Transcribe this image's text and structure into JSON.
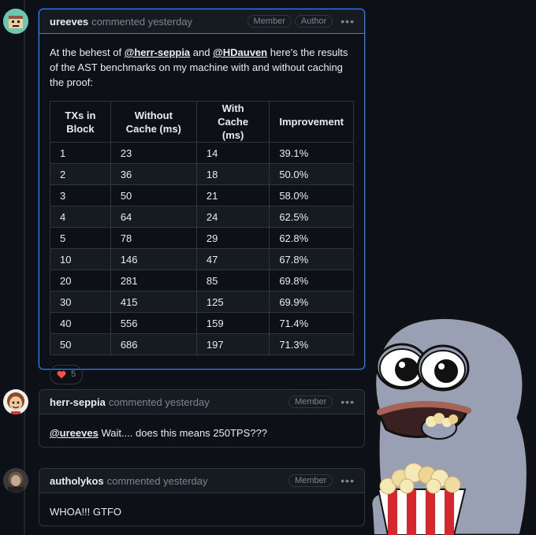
{
  "comments": [
    {
      "author": "ureeves",
      "meta": "commented yesterday",
      "badges": [
        "Member",
        "Author"
      ],
      "text_parts": [
        "At the behest of ",
        "@herr-seppia",
        " and ",
        "@HDauven",
        " here's the results of the AST benchmarks on my machine with and without caching the proof:"
      ],
      "table": {
        "headers": [
          "TXs in Block",
          "Without Cache (ms)",
          "With Cache (ms)",
          "Improvement"
        ],
        "rows": [
          [
            "1",
            "23",
            "14",
            "39.1%"
          ],
          [
            "2",
            "36",
            "18",
            "50.0%"
          ],
          [
            "3",
            "50",
            "21",
            "58.0%"
          ],
          [
            "4",
            "64",
            "24",
            "62.5%"
          ],
          [
            "5",
            "78",
            "29",
            "62.8%"
          ],
          [
            "10",
            "146",
            "47",
            "67.8%"
          ],
          [
            "20",
            "281",
            "85",
            "69.8%"
          ],
          [
            "30",
            "415",
            "125",
            "69.9%"
          ],
          [
            "40",
            "556",
            "159",
            "71.4%"
          ],
          [
            "50",
            "686",
            "197",
            "71.3%"
          ]
        ]
      },
      "reaction": {
        "icon": "heart-icon",
        "count": "5",
        "color": "#f85149"
      }
    },
    {
      "author": "herr-seppia",
      "meta": "commented yesterday",
      "badges": [
        "Member"
      ],
      "text_parts": [
        "@ureeves",
        " Wait.... does this means 250TPS???"
      ]
    },
    {
      "author": "autholykos",
      "meta": "commented yesterday",
      "badges": [
        "Member"
      ],
      "text_parts": [
        "WHOA!!! GTFO"
      ]
    }
  ],
  "menu_icon": "kebab-icon",
  "colors": {
    "background": "#0d1117",
    "border": "#30363d",
    "accent": "#2f81f7",
    "muted": "#7d8590"
  }
}
